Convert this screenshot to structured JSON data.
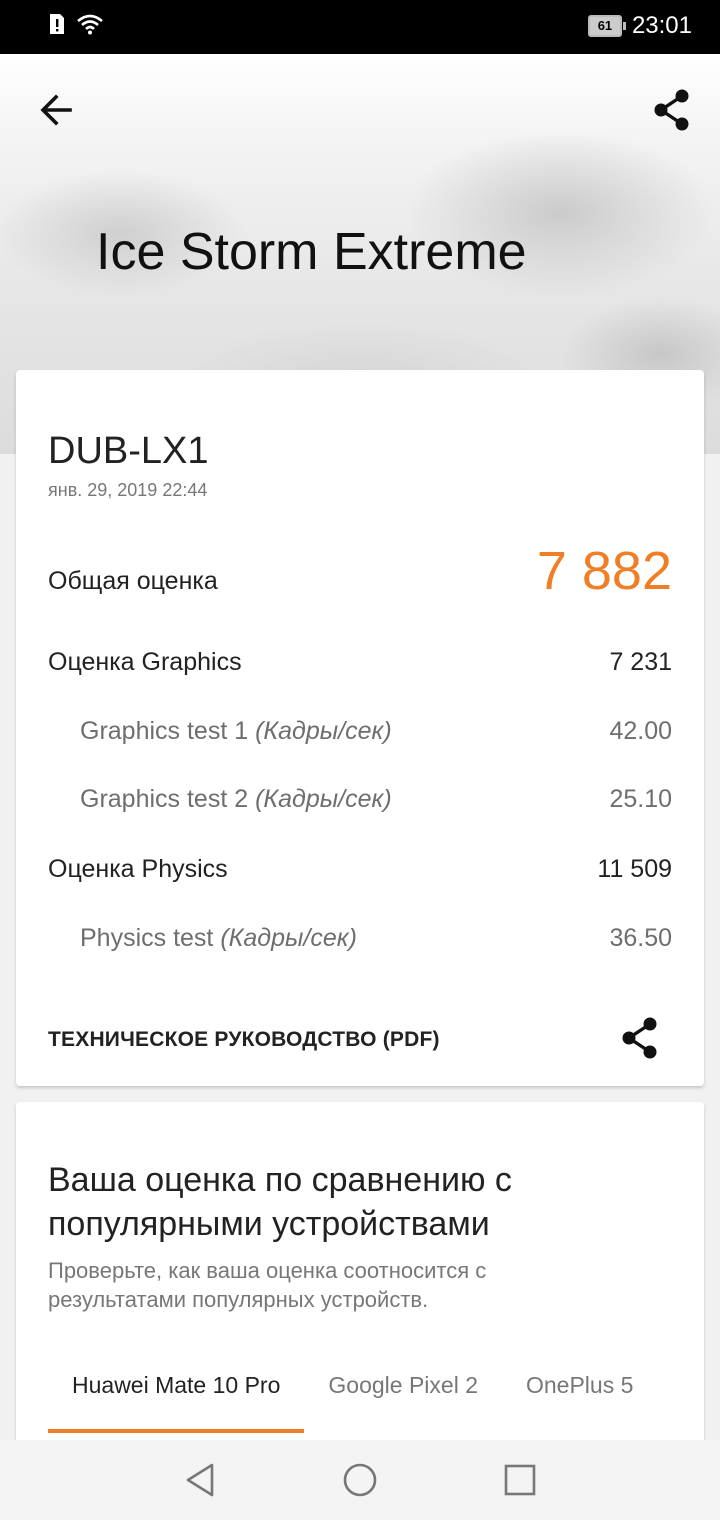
{
  "status": {
    "time": "23:01",
    "battery": "61"
  },
  "hero": {
    "title": "Ice Storm Extreme"
  },
  "result": {
    "device": "DUB-LX1",
    "date": "янв. 29, 2019 22:44",
    "total_label": "Общая оценка",
    "total_value": "7 882",
    "rows": [
      {
        "label": "Оценка Graphics",
        "unit": "",
        "value": "7 231"
      },
      {
        "label": "Graphics test 1",
        "unit": "(Кадры/сек)",
        "value": "42.00"
      },
      {
        "label": "Graphics test 2",
        "unit": "(Кадры/сек)",
        "value": "25.10"
      },
      {
        "label": "Оценка Physics",
        "unit": "",
        "value": "11 509"
      },
      {
        "label": "Physics test",
        "unit": "(Кадры/сек)",
        "value": "36.50"
      }
    ],
    "pdf_link": "ТЕХНИЧЕСКОЕ РУКОВОДСТВО (PDF)"
  },
  "compare": {
    "title": "Ваша оценка по сравнению с популярными устройствами",
    "description": "Проверьте, как ваша оценка соотносится с результатами популярных устройств.",
    "tabs": [
      {
        "label": "Huawei Mate 10 Pro"
      },
      {
        "label": "Google Pixel 2"
      },
      {
        "label": "OnePlus 5"
      }
    ]
  },
  "colors": {
    "accent": "#f07e26"
  },
  "icons": {
    "back": "arrow-left-icon",
    "share": "share-icon",
    "nav_back": "triangle-back-icon",
    "nav_home": "circle-home-icon",
    "nav_recent": "square-recent-icon"
  }
}
